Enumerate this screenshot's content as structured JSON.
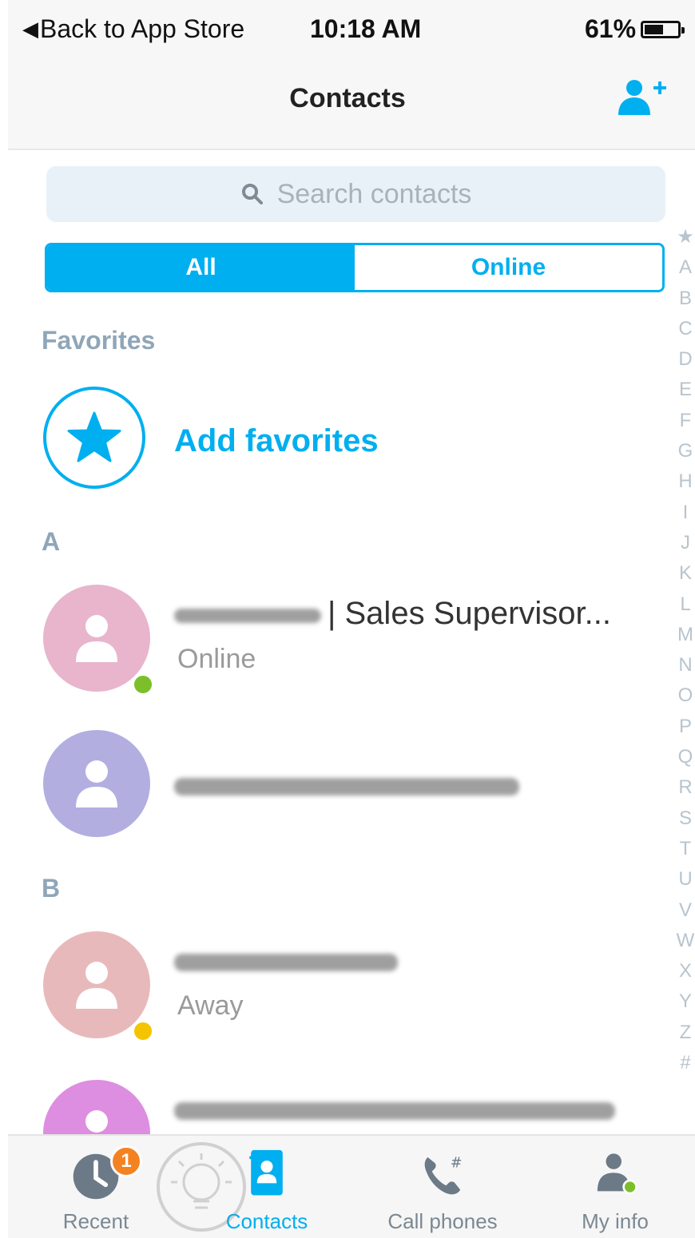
{
  "status_bar": {
    "back_label": "Back to App Store",
    "time": "10:18 AM",
    "battery_percent": "61%",
    "battery_level": 0.61
  },
  "nav": {
    "title": "Contacts",
    "add_contact_icon": "add-contact-icon"
  },
  "search": {
    "placeholder": "Search contacts"
  },
  "segments": {
    "all": "All",
    "online": "Online",
    "selected": "All"
  },
  "favorites": {
    "header": "Favorites",
    "add_label": "Add favorites"
  },
  "sections": [
    {
      "letter": "A",
      "contacts": [
        {
          "name_suffix": "| Sales Supervisor...",
          "status": "Online",
          "presence": "online",
          "avatar_color": "#e8b5cd"
        },
        {
          "name_suffix": "",
          "status": "",
          "presence": "",
          "avatar_color": "#b3aee0"
        }
      ]
    },
    {
      "letter": "B",
      "contacts": [
        {
          "name_suffix": "",
          "status": "Away",
          "presence": "away",
          "avatar_color": "#e8b9bb"
        },
        {
          "name_suffix": "",
          "status": "",
          "presence": "",
          "avatar_color": "#dd8ee0"
        }
      ]
    }
  ],
  "alphabet_index": [
    "★",
    "A",
    "B",
    "C",
    "D",
    "E",
    "F",
    "G",
    "H",
    "I",
    "J",
    "K",
    "L",
    "M",
    "N",
    "O",
    "P",
    "Q",
    "R",
    "S",
    "T",
    "U",
    "V",
    "W",
    "X",
    "Y",
    "Z",
    "#"
  ],
  "tabs": {
    "recent": {
      "label": "Recent",
      "badge": "1"
    },
    "contacts": {
      "label": "Contacts"
    },
    "call_phones": {
      "label": "Call phones"
    },
    "my_info": {
      "label": "My info"
    }
  },
  "colors": {
    "accent": "#00aff0",
    "online": "#7cbf2b",
    "away": "#f5c400",
    "badge": "#f58220"
  }
}
